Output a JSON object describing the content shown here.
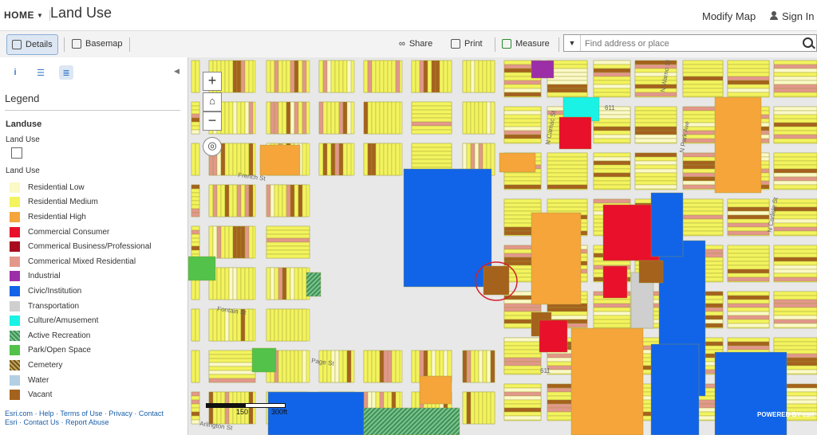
{
  "header": {
    "home": "HOME",
    "title": "Land Use",
    "modify_map": "Modify Map",
    "sign_in": "Sign In"
  },
  "toolbar": {
    "details": "Details",
    "basemap": "Basemap",
    "share": "Share",
    "print": "Print",
    "measure": "Measure",
    "search_placeholder": "Find address or place"
  },
  "legend": {
    "heading": "Legend",
    "layer": "Landuse",
    "sublayer1": "Land Use",
    "sublayer2": "Land Use",
    "items": [
      {
        "label": "Residential Low",
        "color": "#fbf9c6"
      },
      {
        "label": "Residential Medium",
        "color": "#f3f35e"
      },
      {
        "label": "Residential High",
        "color": "#f5a53a"
      },
      {
        "label": "Commercial Consumer",
        "color": "#e8102a"
      },
      {
        "label": "Commerical Business/Professional",
        "color": "#a80b1d"
      },
      {
        "label": "Commerical Mixed Residential",
        "color": "#e3978b"
      },
      {
        "label": "Industrial",
        "color": "#9c2ea8"
      },
      {
        "label": "Civic/Institution",
        "color": "#1164e8"
      },
      {
        "label": "Transportation",
        "color": "#cfcfcf"
      },
      {
        "label": "Culture/Amusement",
        "color": "#19f2e4"
      },
      {
        "label": "Active Recreation",
        "color": "#3c8f5c"
      },
      {
        "label": "Park/Open Space",
        "color": "#52c24a"
      },
      {
        "label": "Cemetery",
        "color": "#a07a3a"
      },
      {
        "label": "Water",
        "color": "#b3cfe3"
      },
      {
        "label": "Vacant",
        "color": "#a5621d"
      }
    ]
  },
  "footer": {
    "line1": "Esri.com · Help · Terms of Use · Privacy · Contact",
    "line2": "Esri · Contact Us · Report Abuse"
  },
  "map": {
    "streets": [
      "French St",
      "Fontain St",
      "Page St",
      "Arlington St",
      "N Warno St",
      "N Park Ave",
      "N Camac St",
      "N Carlisle St"
    ],
    "route_shield": "611",
    "scale_label": "150",
    "scale_unit": "300ft",
    "attribution": "POWERED BY esri"
  }
}
